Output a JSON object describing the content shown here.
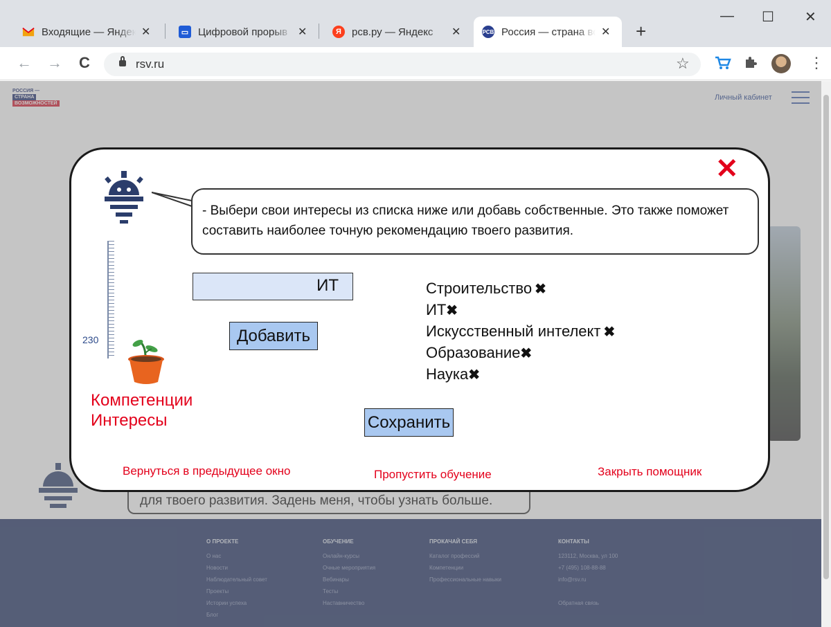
{
  "browser": {
    "tabs": [
      {
        "title": "Входящие — Яндекс.Почта",
        "icon": "gmail-icon",
        "color": "#f2a20f",
        "active": false
      },
      {
        "title": "Цифровой прорыв",
        "icon": "chat-icon",
        "color": "#1e5bd6",
        "active": false
      },
      {
        "title": "рсв.ру — Яндекс",
        "icon": "yandex-icon",
        "color": "#fc3f1d",
        "active": false
      },
      {
        "title": "Россия — страна возможностей",
        "icon": "rsv-icon",
        "color": "#2a3f8f",
        "active": true
      }
    ],
    "tab_close": "✕",
    "new_tab": "+",
    "window_controls": {
      "minimize": "—",
      "maximize": "☐",
      "close": "✕"
    },
    "url": "rsv.ru",
    "icons": {
      "back": "←",
      "forward": "→",
      "reload": "C",
      "star": "☆",
      "menu": "⋮"
    }
  },
  "site": {
    "logo": {
      "line1": "РОССИЯ —",
      "line2": "СТРАНА",
      "line3": "ВОЗМОЖНОСТЕЙ"
    },
    "personal_cabinet": "Личный кабинет",
    "bg_bubble_text": "для твоего развития. Задень меня, чтобы узнать больше.",
    "footer": [
      {
        "heading": "О ПРОЕКТЕ",
        "items": [
          "О нас",
          "Новости",
          "Наблюдательный совет",
          "Проекты",
          "Истории успеха",
          "Блог"
        ]
      },
      {
        "heading": "ОБУЧЕНИЕ",
        "items": [
          "Онлайн-курсы",
          "Очные мероприятия",
          "Вебинары",
          "Тесты",
          "Наставничество"
        ]
      },
      {
        "heading": "ПРОКАЧАЙ СЕБЯ",
        "items": [
          "Каталог профессий",
          "Компетенции",
          "Профессиональные навыки"
        ]
      },
      {
        "heading": "КОНТАКТЫ",
        "items": [
          "123112, Москва, ул 100",
          "+7 (495) 108-88-88",
          "info@rsv.ru",
          "",
          "Обратная связь"
        ]
      }
    ]
  },
  "modal": {
    "close_icon": "✕",
    "ruler_value": "230",
    "side_labels": [
      "Компетенции",
      "Интересы"
    ],
    "bubble_text": " -  Выбери свои интересы из списка ниже или добавь собственные. Это также поможет составить наиболее точную рекомендацию твоего развития.",
    "input_value": "ИТ",
    "add_button": "Добавить",
    "save_button": "Сохранить",
    "tags": [
      "Строительство",
      "ИТ",
      "Искусственный интелект",
      "Образование",
      "Наука"
    ],
    "tag_remove": "✖",
    "links": {
      "back": "Вернуться в предыдущее окно",
      "skip": "Пропустить обучение",
      "close": "Закрыть помощник"
    },
    "accent_color": "#e3001b"
  }
}
